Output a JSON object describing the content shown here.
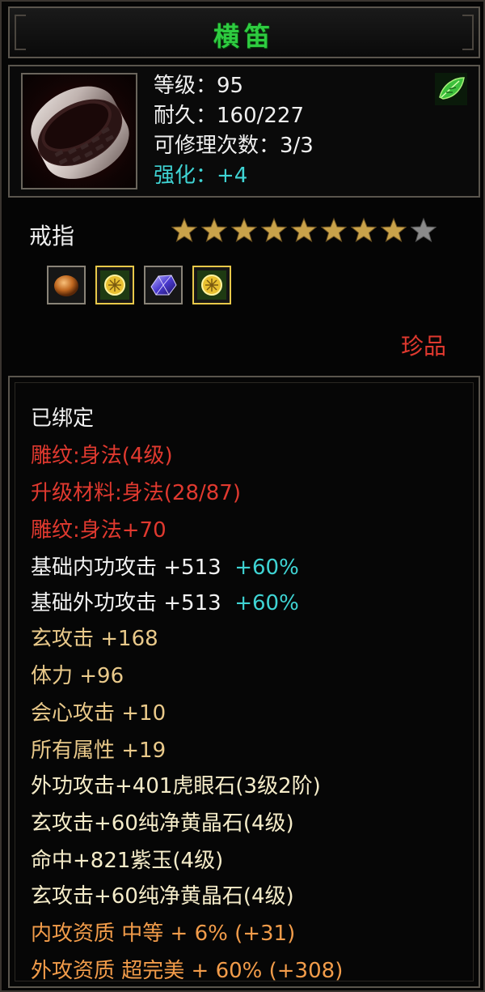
{
  "item": {
    "name": "横笛",
    "type": "戒指",
    "rarity": "珍品",
    "stars_total": 9,
    "stars_filled": 8
  },
  "stats": {
    "level": "等级：95",
    "durability": "耐久：160/227",
    "repair": "可修理次数：3/3",
    "enhance": "强化：+4"
  },
  "gems": [
    {
      "name": "amber-gem"
    },
    {
      "name": "yellow-crystal-gem"
    },
    {
      "name": "purple-jade-gem"
    },
    {
      "name": "yellow-crystal-gem"
    }
  ],
  "details": {
    "bound": "已绑定",
    "engrave1": "雕纹:身法(4级)",
    "upgrade_material": "升级材料:身法(28/87)",
    "engrave2": "雕纹:身法+70",
    "base_inner_label": "基础内功攻击  +513",
    "base_inner_pct": "+60%",
    "base_outer_label": "基础外功攻击  +513",
    "base_outer_pct": "+60%",
    "xuan_attack": "玄攻击  +168",
    "stamina": "体力  +96",
    "crit": "会心攻击  +10",
    "all_attr": "所有属性  +19",
    "gem_line1": "外功攻击+401虎眼石(3级2阶)",
    "gem_line2": "玄攻击+60纯净黄晶石(4级)",
    "gem_line3": "命中+821紫玉(4级)",
    "gem_line4": "玄攻击+60纯净黄晶石(4级)",
    "inner_quality": "内攻资质  中等  +  6% (+31)",
    "outer_quality": "外攻资质  超完美  +  60% (+308)"
  },
  "colors": {
    "title_green": "#2ecc40",
    "red": "#e0392f",
    "gold": "#e9c98a",
    "cyan": "#3fd4d4",
    "orange": "#f29c4a"
  }
}
